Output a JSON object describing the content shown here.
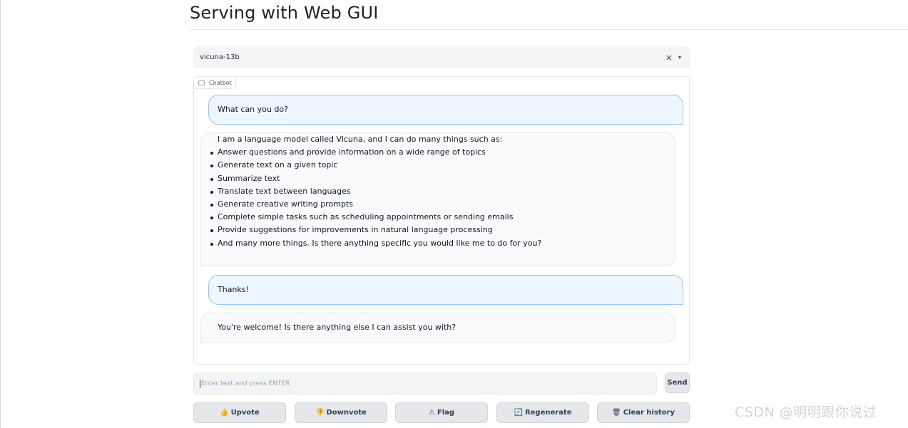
{
  "page": {
    "title": "Serving with Web GUI"
  },
  "model_selector": {
    "value": "vicuna-13b",
    "clear_symbol": "×",
    "caret_symbol": "▾"
  },
  "chatbot": {
    "label": "Chatbot",
    "messages": [
      {
        "role": "user",
        "text": "What can you do?"
      },
      {
        "role": "assistant",
        "intro": "I am a language model called Vicuna, and I can do many things such as:",
        "items": [
          "Answer questions and provide information on a wide range of topics",
          "Generate text on a given topic",
          "Summarize text",
          "Translate text between languages",
          "Generate creative writing prompts",
          "Complete simple tasks such as scheduling appointments or sending emails",
          "Provide suggestions for improvements in natural language processing",
          "And many more things. Is there anything specific you would like me to do for you?"
        ]
      },
      {
        "role": "user",
        "text": "Thanks!"
      },
      {
        "role": "assistant",
        "text": "You're welcome! Is there anything else I can assist you with?"
      }
    ]
  },
  "input": {
    "placeholder": "Enter text and press ENTER",
    "value": ""
  },
  "send_button": {
    "label": "Send"
  },
  "actions": [
    {
      "label": "Upvote",
      "icon": "👍"
    },
    {
      "label": "Downvote",
      "icon": "👎"
    },
    {
      "label": "Flag",
      "icon": "⚠"
    },
    {
      "label": "Regenerate",
      "icon": "🔄"
    },
    {
      "label": "Clear history",
      "icon": "🗑"
    }
  ],
  "watermark": "CSDN @明明跟你说过"
}
